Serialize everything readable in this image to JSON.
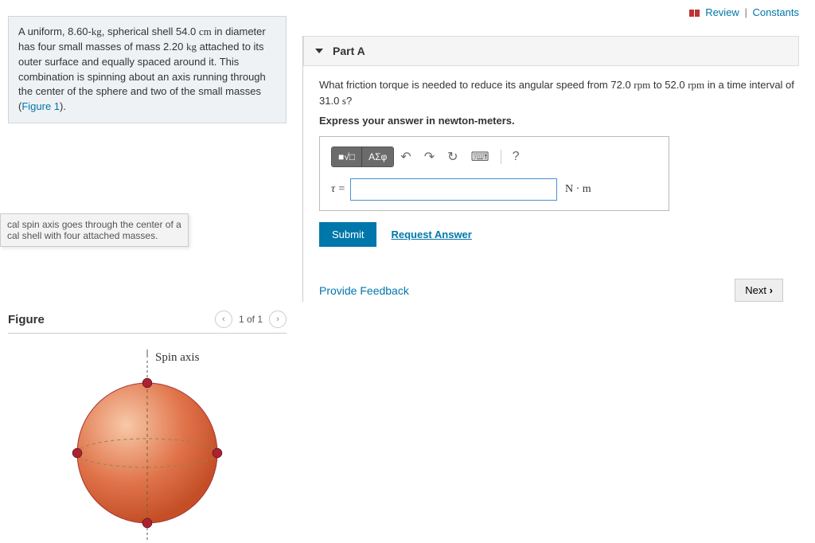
{
  "topLinks": {
    "review": "Review",
    "constants": "Constants"
  },
  "problem": {
    "text_pre": "A uniform, 8.60-",
    "kg": "kg",
    "text_1": ", spherical shell 54.0 ",
    "cm": "cm",
    "text_2": " in diameter has four small masses of mass 2.20 ",
    "text_3": " attached to its outer surface and equally spaced around it. This combination is spinning about an axis running through the center of the sphere and two of the small masses (",
    "figref": "Figure 1",
    "text_4": ")."
  },
  "tooltip": {
    "line1": "cal spin axis goes through the center of a",
    "line2": "cal shell with four attached masses."
  },
  "figure": {
    "title": "Figure",
    "counter": "1 of 1",
    "spinAxis": "Spin axis"
  },
  "partA": {
    "label": "Part A",
    "question_pre": "What friction torque is needed to reduce its angular speed from 72.0 ",
    "rpm": "rpm",
    "question_mid": " to 52.0 ",
    "question_post": " in a time interval of 31.0 ",
    "s": "s",
    "question_end": "?",
    "instruction": "Express your answer in newton-meters.",
    "toolbar": {
      "templates": "■√□",
      "symbols": "ΑΣφ",
      "undo": "↶",
      "redo": "↷",
      "reset": "↻",
      "keyboard": "⌨",
      "help": "?"
    },
    "tau": "τ =",
    "unit": "N · m",
    "submit": "Submit",
    "requestAnswer": "Request Answer"
  },
  "footer": {
    "feedback": "Provide Feedback",
    "next": "Next"
  }
}
